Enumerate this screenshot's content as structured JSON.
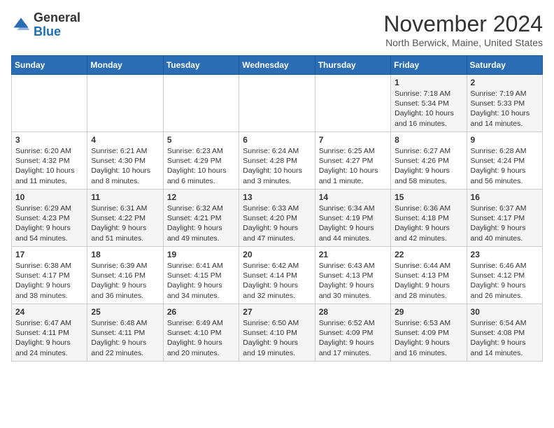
{
  "logo": {
    "general": "General",
    "blue": "Blue"
  },
  "header": {
    "month": "November 2024",
    "location": "North Berwick, Maine, United States"
  },
  "weekdays": [
    "Sunday",
    "Monday",
    "Tuesday",
    "Wednesday",
    "Thursday",
    "Friday",
    "Saturday"
  ],
  "weeks": [
    [
      {
        "day": "",
        "info": ""
      },
      {
        "day": "",
        "info": ""
      },
      {
        "day": "",
        "info": ""
      },
      {
        "day": "",
        "info": ""
      },
      {
        "day": "",
        "info": ""
      },
      {
        "day": "1",
        "info": "Sunrise: 7:18 AM\nSunset: 5:34 PM\nDaylight: 10 hours\nand 16 minutes."
      },
      {
        "day": "2",
        "info": "Sunrise: 7:19 AM\nSunset: 5:33 PM\nDaylight: 10 hours\nand 14 minutes."
      }
    ],
    [
      {
        "day": "3",
        "info": "Sunrise: 6:20 AM\nSunset: 4:32 PM\nDaylight: 10 hours\nand 11 minutes."
      },
      {
        "day": "4",
        "info": "Sunrise: 6:21 AM\nSunset: 4:30 PM\nDaylight: 10 hours\nand 8 minutes."
      },
      {
        "day": "5",
        "info": "Sunrise: 6:23 AM\nSunset: 4:29 PM\nDaylight: 10 hours\nand 6 minutes."
      },
      {
        "day": "6",
        "info": "Sunrise: 6:24 AM\nSunset: 4:28 PM\nDaylight: 10 hours\nand 3 minutes."
      },
      {
        "day": "7",
        "info": "Sunrise: 6:25 AM\nSunset: 4:27 PM\nDaylight: 10 hours\nand 1 minute."
      },
      {
        "day": "8",
        "info": "Sunrise: 6:27 AM\nSunset: 4:26 PM\nDaylight: 9 hours\nand 58 minutes."
      },
      {
        "day": "9",
        "info": "Sunrise: 6:28 AM\nSunset: 4:24 PM\nDaylight: 9 hours\nand 56 minutes."
      }
    ],
    [
      {
        "day": "10",
        "info": "Sunrise: 6:29 AM\nSunset: 4:23 PM\nDaylight: 9 hours\nand 54 minutes."
      },
      {
        "day": "11",
        "info": "Sunrise: 6:31 AM\nSunset: 4:22 PM\nDaylight: 9 hours\nand 51 minutes."
      },
      {
        "day": "12",
        "info": "Sunrise: 6:32 AM\nSunset: 4:21 PM\nDaylight: 9 hours\nand 49 minutes."
      },
      {
        "day": "13",
        "info": "Sunrise: 6:33 AM\nSunset: 4:20 PM\nDaylight: 9 hours\nand 47 minutes."
      },
      {
        "day": "14",
        "info": "Sunrise: 6:34 AM\nSunset: 4:19 PM\nDaylight: 9 hours\nand 44 minutes."
      },
      {
        "day": "15",
        "info": "Sunrise: 6:36 AM\nSunset: 4:18 PM\nDaylight: 9 hours\nand 42 minutes."
      },
      {
        "day": "16",
        "info": "Sunrise: 6:37 AM\nSunset: 4:17 PM\nDaylight: 9 hours\nand 40 minutes."
      }
    ],
    [
      {
        "day": "17",
        "info": "Sunrise: 6:38 AM\nSunset: 4:17 PM\nDaylight: 9 hours\nand 38 minutes."
      },
      {
        "day": "18",
        "info": "Sunrise: 6:39 AM\nSunset: 4:16 PM\nDaylight: 9 hours\nand 36 minutes."
      },
      {
        "day": "19",
        "info": "Sunrise: 6:41 AM\nSunset: 4:15 PM\nDaylight: 9 hours\nand 34 minutes."
      },
      {
        "day": "20",
        "info": "Sunrise: 6:42 AM\nSunset: 4:14 PM\nDaylight: 9 hours\nand 32 minutes."
      },
      {
        "day": "21",
        "info": "Sunrise: 6:43 AM\nSunset: 4:13 PM\nDaylight: 9 hours\nand 30 minutes."
      },
      {
        "day": "22",
        "info": "Sunrise: 6:44 AM\nSunset: 4:13 PM\nDaylight: 9 hours\nand 28 minutes."
      },
      {
        "day": "23",
        "info": "Sunrise: 6:46 AM\nSunset: 4:12 PM\nDaylight: 9 hours\nand 26 minutes."
      }
    ],
    [
      {
        "day": "24",
        "info": "Sunrise: 6:47 AM\nSunset: 4:11 PM\nDaylight: 9 hours\nand 24 minutes."
      },
      {
        "day": "25",
        "info": "Sunrise: 6:48 AM\nSunset: 4:11 PM\nDaylight: 9 hours\nand 22 minutes."
      },
      {
        "day": "26",
        "info": "Sunrise: 6:49 AM\nSunset: 4:10 PM\nDaylight: 9 hours\nand 20 minutes."
      },
      {
        "day": "27",
        "info": "Sunrise: 6:50 AM\nSunset: 4:10 PM\nDaylight: 9 hours\nand 19 minutes."
      },
      {
        "day": "28",
        "info": "Sunrise: 6:52 AM\nSunset: 4:09 PM\nDaylight: 9 hours\nand 17 minutes."
      },
      {
        "day": "29",
        "info": "Sunrise: 6:53 AM\nSunset: 4:09 PM\nDaylight: 9 hours\nand 16 minutes."
      },
      {
        "day": "30",
        "info": "Sunrise: 6:54 AM\nSunset: 4:08 PM\nDaylight: 9 hours\nand 14 minutes."
      }
    ]
  ]
}
